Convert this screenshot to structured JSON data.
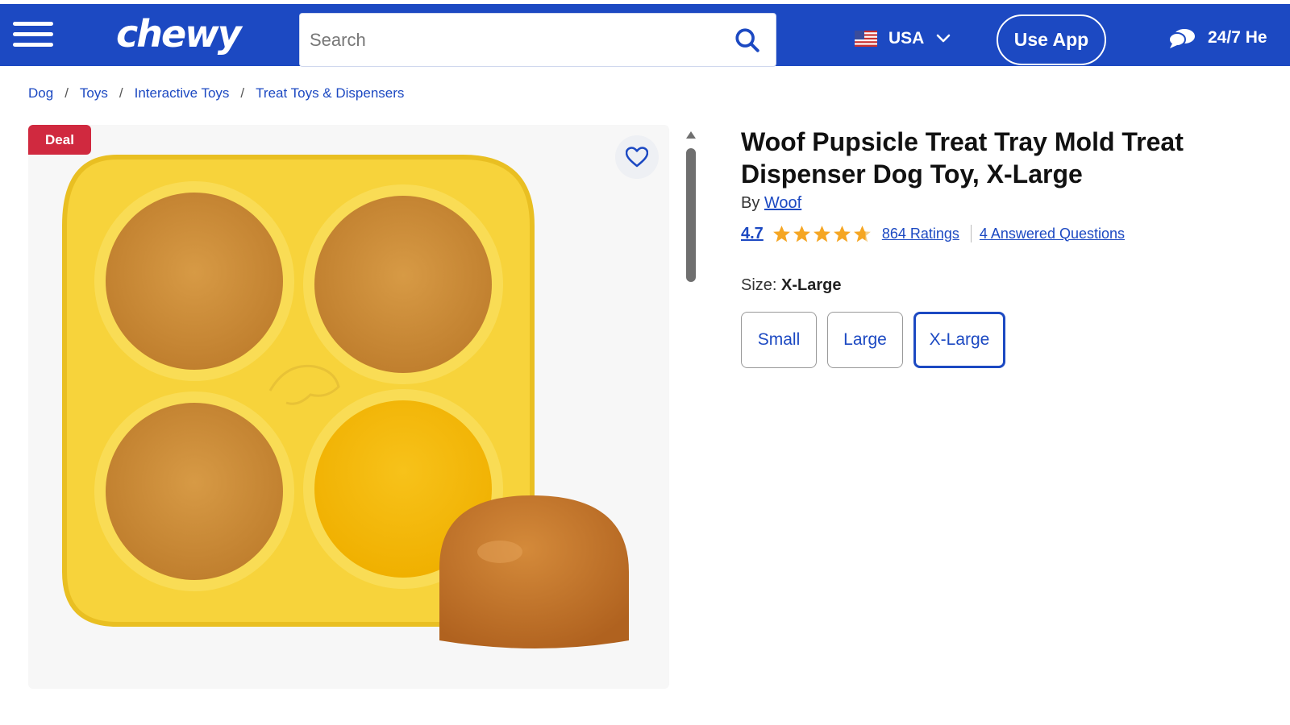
{
  "header": {
    "logo": "chewy",
    "search_placeholder": "Search",
    "country": "USA",
    "use_app_label": "Use App",
    "support_label": "24/7 He",
    "brand_color": "#1c49c2"
  },
  "breadcrumb": [
    "Dog",
    "Toys",
    "Interactive Toys",
    "Treat Toys & Dispensers"
  ],
  "gallery": {
    "badge": "Deal"
  },
  "product": {
    "title": "Woof Pupsicle Treat Tray Mold Treat Dispenser Dog Toy, X-Large",
    "by_prefix": "By",
    "brand": "Woof",
    "rating": "4.7",
    "ratings_count": "864 Ratings",
    "questions": "4 Answered Questions",
    "size_prefix": "Size:",
    "selected_size": "X-Large",
    "sizes": [
      "Small",
      "Large",
      "X-Large"
    ]
  },
  "colors": {
    "deal": "#d0293f",
    "star": "#f5a623",
    "tray": "#f7d33b"
  }
}
